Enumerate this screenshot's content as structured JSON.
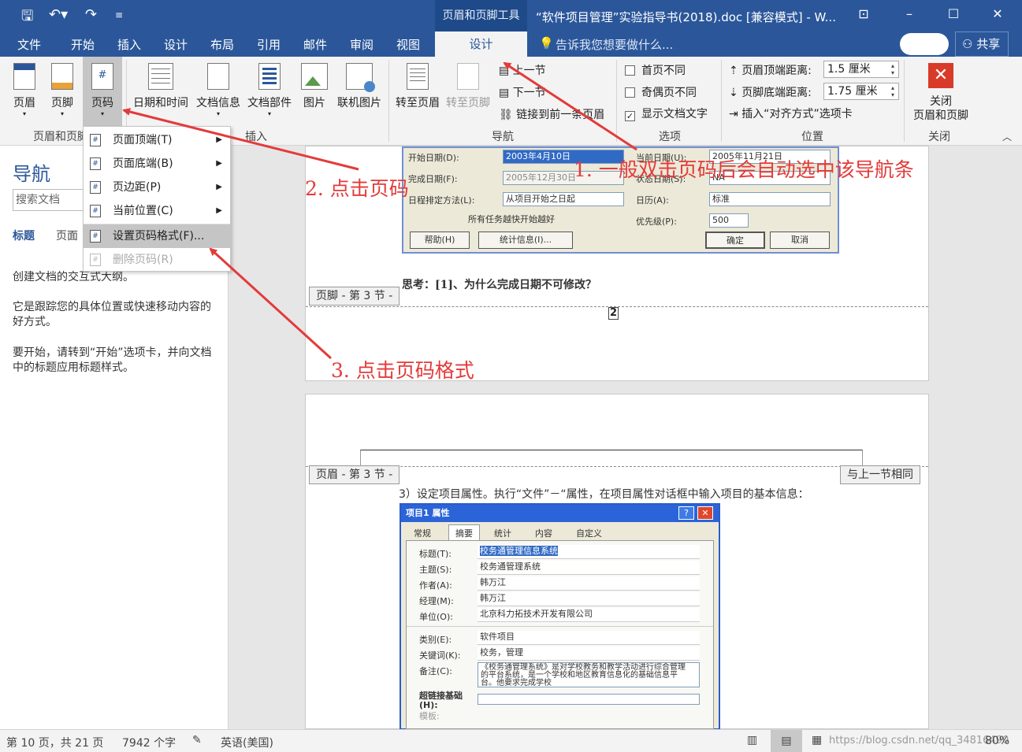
{
  "window": {
    "context_group": "页眉和页脚工具",
    "title": "“软件项目管理”实验指导书(2018).doc [兼容模式] - W...",
    "share": "共享",
    "tell_me": "告诉我您想要做什么..."
  },
  "tabs": [
    "文件",
    "开始",
    "插入",
    "设计",
    "布局",
    "引用",
    "邮件",
    "审阅",
    "视图",
    "设计"
  ],
  "ribbon": {
    "header": "页眉",
    "footer": "页脚",
    "page_number": "页码",
    "group_header_footer": "页眉和页脚",
    "date_time": "日期和时间",
    "doc_info": "文档信息",
    "doc_parts": "文档部件",
    "picture": "图片",
    "online_picture": "联机图片",
    "group_insert": "插入",
    "goto_header": "转至页眉",
    "goto_footer": "转至页脚",
    "prev_section": "上一节",
    "next_section": "下一节",
    "link_previous": "链接到前一条页眉",
    "group_nav": "导航",
    "diff_first": "首页不同",
    "diff_odd_even": "奇偶页不同",
    "show_doc_text": "显示文档文字",
    "group_options": "选项",
    "header_top_label": "页眉顶端距离:",
    "header_top_value": "1.5 厘米",
    "footer_bottom_label": "页脚底端距离:",
    "footer_bottom_value": "1.75 厘米",
    "insert_align_tab": "插入“对齐方式”选项卡",
    "group_position": "位置",
    "close_label": "关闭\n页眉和页脚",
    "close_line1": "关闭",
    "close_line2": "页眉和页脚",
    "group_close": "关闭"
  },
  "menu": {
    "items": [
      {
        "label": "页面顶端(T)",
        "arrow": true,
        "icon": "#"
      },
      {
        "label": "页面底端(B)",
        "arrow": true,
        "icon": "#"
      },
      {
        "label": "页边距(P)",
        "arrow": true,
        "icon": "#"
      },
      {
        "label": "当前位置(C)",
        "arrow": true,
        "icon": "#"
      },
      {
        "label": "设置页码格式(F)...",
        "arrow": false,
        "icon": "#"
      },
      {
        "label": "删除页码(R)",
        "arrow": false,
        "icon": "#"
      }
    ]
  },
  "nav": {
    "title": "导航",
    "search_placeholder": "搜索文档",
    "tab_headings": "标题",
    "tab_pages": "页面",
    "text1": "创建文档的交互式大纲。",
    "text2": "它是跟踪您的具体位置或快速移动内容的好方式。",
    "text3": "要开始，请转到“开始”选项卡，并向文档中的标题应用标题样式。"
  },
  "doc": {
    "dialog1": {
      "start_date_label": "开始日期(D):",
      "start_date": "2003年4月10日",
      "finish_date_label": "完成日期(F):",
      "finish_date": "2005年12月30日",
      "schedule_label": "日程排定方法(L):",
      "schedule": "从项目开始之日起",
      "note": "所有任务越快开始越好",
      "current_date_label": "当前日期(U):",
      "current_date": "2005年11月21日",
      "status_date_label": "状态日期(S):",
      "status_date": "NA",
      "calendar_label": "日历(A):",
      "calendar": "标准",
      "priority_label": "优先级(P):",
      "priority": "500",
      "help": "帮助(H)",
      "stats": "统计信息(I)...",
      "ok": "确定",
      "cancel": "取消"
    },
    "question": "思考：[1]、为什么完成日期不可修改？",
    "footer_tag": "页脚 - 第 3 节 -",
    "page_num": "2",
    "header_tag": "页眉 - 第 3 节 -",
    "same_as_prev": "与上一节相同",
    "step3": "3）设定项目属性。执行“文件”－“属性，在项目属性对话框中输入项目的基本信息：",
    "dialog2": {
      "title": "项目1 属性",
      "tabs": [
        "常规",
        "摘要",
        "统计",
        "内容",
        "自定义"
      ],
      "fields": [
        {
          "label": "标题(T):",
          "value": "校务通管理信息系统"
        },
        {
          "label": "主题(S):",
          "value": "校务通管理系统"
        },
        {
          "label": "作者(A):",
          "value": "韩万江"
        },
        {
          "label": "经理(M):",
          "value": "韩万江"
        },
        {
          "label": "单位(O):",
          "value": "北京科力拓技术开发有限公司"
        },
        {
          "label": "类别(E):",
          "value": "软件项目"
        },
        {
          "label": "关键词(K):",
          "value": "校务，管理"
        }
      ],
      "notes_label": "备注(C):",
      "notes": "《校务通管理系统》是对学校教务和教学活动进行综合管理的平台系统，是一个学校和地区教育信息化的基础信息平台。他要求完成学校",
      "hyperlink_label": "超链接基础(H):",
      "template_label": "模板:"
    }
  },
  "annotations": {
    "a1": "1. 一般双击页码后会自动选中该导航条",
    "a2": "2. 点击页码",
    "a3": "3. 点击页码格式"
  },
  "status": {
    "page": "第 10 页，共 21 页",
    "words": "7942 个字",
    "lang": "英语(美国)",
    "zoom": "80%",
    "watermark": "https://blog.csdn.net/qq_34816490"
  },
  "colors": {
    "accent": "#2b579a",
    "annotation": "#e43a3a"
  }
}
